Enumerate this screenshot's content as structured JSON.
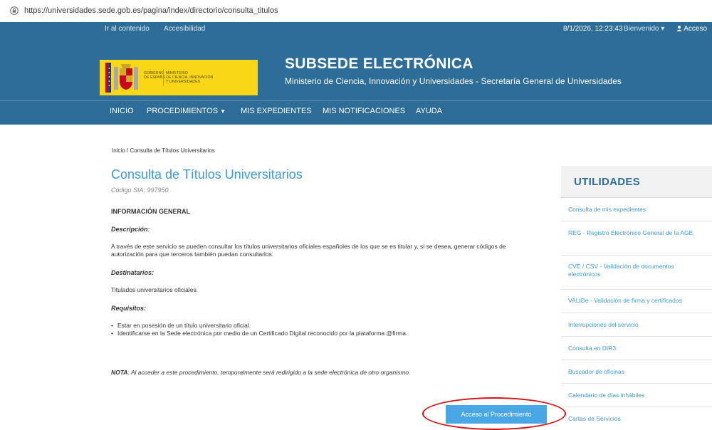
{
  "browser": {
    "url": "https://universidades.sede.gob.es/pagina/index/directorio/consulta_titulos"
  },
  "topbar": {
    "skip_link": "Ir al contenido",
    "accessibility": "Accesibilidad",
    "datetime": "8/1/2026, 12:23:43",
    "welcome": "Bienvenido ▾",
    "access": "Acceso"
  },
  "logo": {
    "gov": "GOBIERNO\nDE ESPAÑA",
    "ministry": "MINISTERIO\nDE CIENCIA, INNOVACIÓN\nY UNIVERSIDADES"
  },
  "brand": {
    "title": "SUBSEDE ELECTRÓNICA",
    "subtitle": "Ministerio de Ciencia, Innovación y Universidades - Secretaría General de Universidades"
  },
  "nav": {
    "inicio": "INICIO",
    "procedimientos": "PROCEDIMIENTOS",
    "expedientes": "MIS EXPEDIENTES",
    "notificaciones": "MIS NOTIFICACIONES",
    "ayuda": "AYUDA"
  },
  "breadcrumb": "Inicio / Consulta de Títulos Universitarios",
  "page": {
    "title": "Consulta de Títulos Universitarios",
    "sia": "Código SIA: 997950",
    "info_heading": "INFORMACIÓN GENERAL",
    "desc_heading": "Descripción",
    "desc_colon": ":",
    "desc_text": "A través de este servicio se pueden consultar los títulos universitarios oficiales españoles de los que se es titular y, si se desea, generar códigos de autorización para que terceros también puedan consultarlos.",
    "dest_heading": "Destinatarios:",
    "dest_text": "Titulados universitarios oficiales.",
    "req_heading": "Requisitos:",
    "req_items": [
      "Estar en posesión de un título universitario oficial.",
      "Identificarse en la Sede electrónica por medio de un Certificado Digital reconocido por la plataforma @firma."
    ],
    "nota_label": "NOTA",
    "nota_text": ": Al acceder a este procedimiento, temporalmente será redirigido a la sede electrónica de otro organismo.",
    "access_button": "Acceso al Procedimiento"
  },
  "sidebar": {
    "heading": "UTILIDADES",
    "items": [
      "Consulta de mis expedientes",
      "REG - Registro Electrónico General de la AGE",
      "CVE / CSV - Validación de documentos electrónicos",
      "VALIDe - Validación de firma y certificados",
      "Interrupciones del servicio",
      "Consulta en DIR3",
      "Buscador de oficinas",
      "Calendario de días inhábiles",
      "Cartas de Servicios"
    ]
  },
  "colors": {
    "header": "#2d6d98",
    "link": "#3d9ad7",
    "button": "#4aa7e6",
    "logo": "#f9d616",
    "highlight": "#d61212"
  }
}
